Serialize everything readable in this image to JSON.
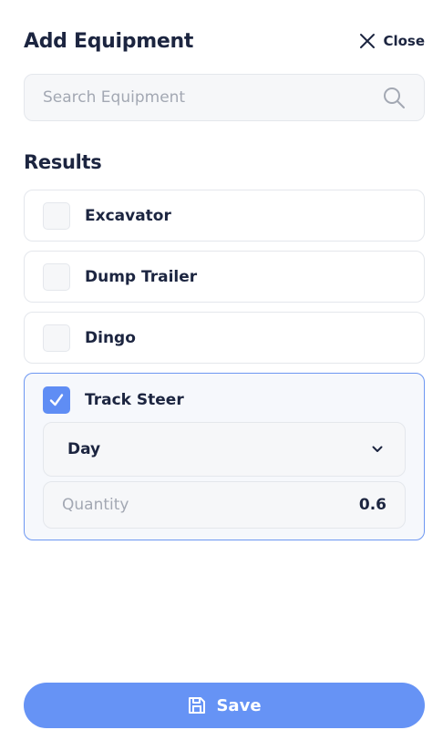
{
  "header": {
    "title": "Add Equipment",
    "close_label": "Close"
  },
  "search": {
    "placeholder": "Search Equipment",
    "value": ""
  },
  "results": {
    "title": "Results",
    "items": [
      {
        "label": "Excavator",
        "checked": false
      },
      {
        "label": "Dump Trailer",
        "checked": false
      },
      {
        "label": "Dingo",
        "checked": false
      },
      {
        "label": "Track Steer",
        "checked": true
      }
    ]
  },
  "selected_item": {
    "rate_select": {
      "value": "Day"
    },
    "quantity": {
      "label": "Quantity",
      "value": "0.6"
    }
  },
  "footer": {
    "save_label": "Save"
  },
  "colors": {
    "accent": "#6693f5",
    "checkbox_checked": "#5f8df4",
    "text_primary": "#1c2540",
    "text_placeholder": "#a3a8b3",
    "border": "#e4e7ec"
  },
  "icons": {
    "close": "close-icon",
    "search": "search-icon",
    "checkmark": "checkmark-icon",
    "chevron": "chevron-down-icon",
    "save": "save-icon"
  }
}
